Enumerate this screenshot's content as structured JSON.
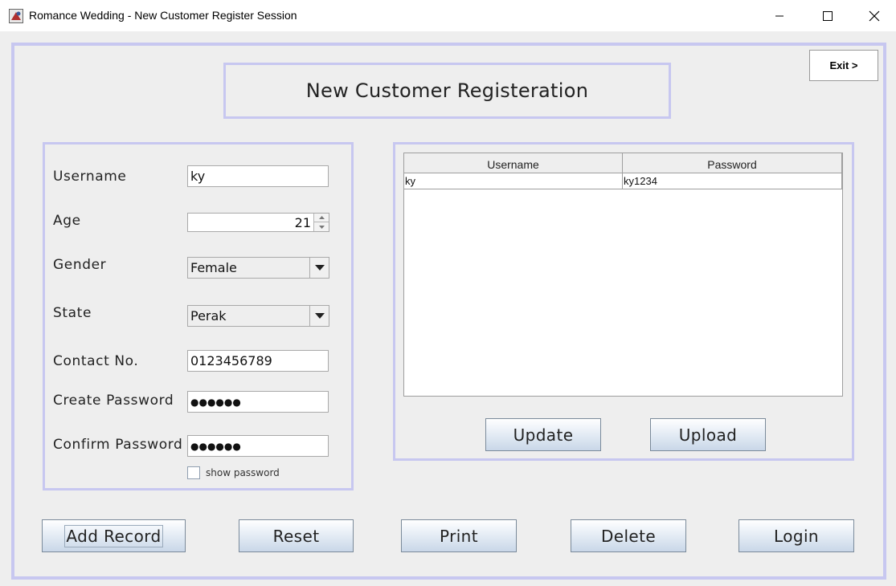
{
  "window": {
    "title": "Romance Wedding - New Customer Register Session"
  },
  "header": {
    "heading": "New Customer Registeration",
    "exit_label": "Exit >"
  },
  "form": {
    "labels": {
      "username": "Username",
      "age": "Age",
      "gender": "Gender",
      "state": "State",
      "contact": "Contact No.",
      "create_password": "Create Password",
      "confirm_password": "Confirm Password"
    },
    "values": {
      "username": "ky",
      "age": "21",
      "gender": "Female",
      "state": "Perak",
      "contact": "0123456789",
      "create_password": "●●●●●●",
      "confirm_password": "●●●●●●"
    },
    "show_password_label": "show password",
    "show_password_checked": false
  },
  "table": {
    "columns": [
      "Username",
      "Password"
    ],
    "rows": [
      [
        "ky",
        "ky1234"
      ]
    ]
  },
  "panel_buttons": {
    "update": "Update",
    "upload": "Upload"
  },
  "bottom_buttons": {
    "add_record": "Add Record",
    "reset": "Reset",
    "print": "Print",
    "delete": "Delete",
    "login": "Login"
  },
  "icons": {
    "app": "java-app-icon",
    "minimize": "minimize-icon",
    "maximize": "maximize-icon",
    "close": "close-icon",
    "dropdown": "chevron-down-icon"
  }
}
